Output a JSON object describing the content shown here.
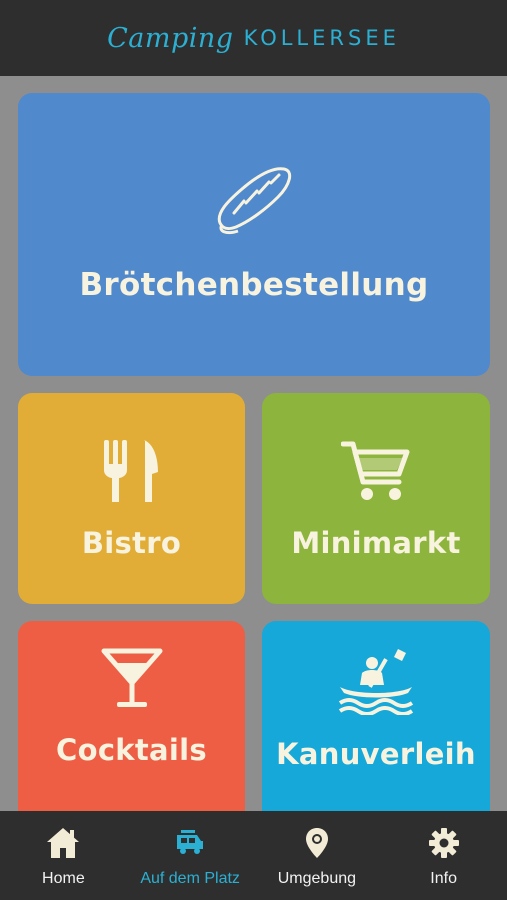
{
  "header": {
    "logo_script": "Camping",
    "logo_caps": "KOLLERSEE"
  },
  "colors": {
    "header_bg": "#2e2e2e",
    "brand_accent": "#2bb0d3",
    "tile_broetchen": "#5089cc",
    "tile_bistro": "#e2ad37",
    "tile_minimarkt": "#8db43c",
    "tile_cocktails": "#ee5e45",
    "tile_kanu": "#15a8d8"
  },
  "tiles": {
    "broetchen": {
      "label": "Brötchenbestellung",
      "icon": "bread-icon"
    },
    "bistro": {
      "label": "Bistro",
      "icon": "cutlery-icon"
    },
    "minimarkt": {
      "label": "Minimarkt",
      "icon": "cart-icon"
    },
    "cocktails": {
      "label": "Cocktails",
      "icon": "cocktail-icon"
    },
    "kanu": {
      "label": "Kanuverleih",
      "icon": "kayak-icon"
    }
  },
  "bottom_nav": {
    "items": [
      {
        "label": "Home",
        "icon": "home-icon",
        "active": false
      },
      {
        "label": "Auf dem Platz",
        "icon": "camper-icon",
        "active": true
      },
      {
        "label": "Umgebung",
        "icon": "location-pin-icon",
        "active": false
      },
      {
        "label": "Info",
        "icon": "gear-icon",
        "active": false
      }
    ]
  }
}
